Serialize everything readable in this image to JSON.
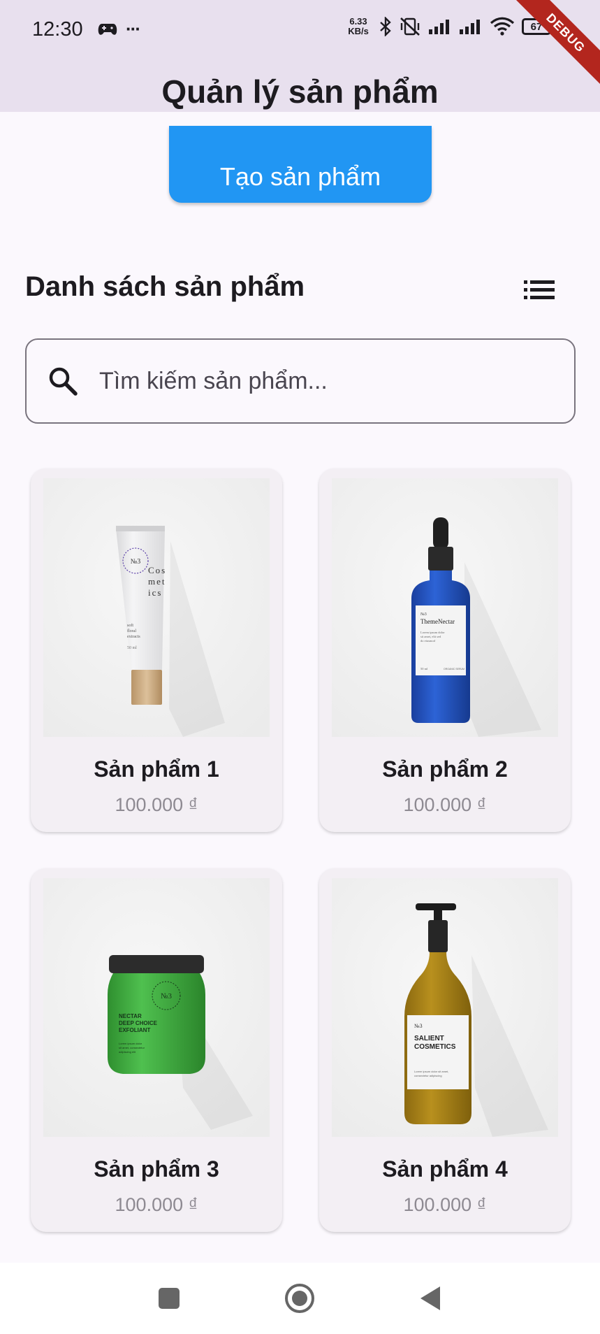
{
  "status_bar": {
    "time": "12:30",
    "more": "···",
    "net_speed_value": "6.33",
    "net_speed_unit": "KB/s",
    "battery": "67",
    "debug_banner": "DEBUG",
    "icons": [
      "game-controller-icon",
      "bluetooth-icon",
      "vibrate-off-icon",
      "signal-icon",
      "signal-icon",
      "wifi-icon",
      "battery-icon"
    ]
  },
  "app_bar": {
    "title": "Quản lý sản phẩm",
    "background": "#e8e0ee"
  },
  "actions": {
    "create_label": "Tạo sản phẩm",
    "accent": "#2196f3"
  },
  "list": {
    "title": "Danh sách sản phẩm",
    "toggle_icon": "list-icon"
  },
  "search": {
    "placeholder": "Tìm kiếm sản phẩm...",
    "icon": "search-icon"
  },
  "products": [
    {
      "name": "Sản phẩm 1",
      "price": "100.000 ₫",
      "image": "cosmetic-tube"
    },
    {
      "name": "Sản phẩm 2",
      "price": "100.000 ₫",
      "image": "dropper-bottle"
    },
    {
      "name": "Sản phẩm 3",
      "price": "100.000 ₫",
      "image": "green-jar"
    },
    {
      "name": "Sản phẩm 4",
      "price": "100.000 ₫",
      "image": "pump-bottle"
    }
  ],
  "product_labels": {
    "tube": {
      "badge": "№3",
      "brand_lines": [
        "Cos",
        "met",
        "ics"
      ],
      "ring": "COSMETICS · NATURAL ·",
      "note": [
        "soft",
        "floral",
        "extracts"
      ],
      "volume": "50 ml"
    },
    "dropper": {
      "badge": "№3",
      "brand": "ThemeNectar",
      "desc": [
        "Lorem ipsum dolor",
        "sit amet, elit sed",
        "do eiusmod"
      ],
      "volume": "50 ml",
      "footer": "ORGANIC SERUM"
    },
    "jar": {
      "badge": "№3",
      "ring": "NECTAR · SALIENT ·",
      "brand_lines": [
        "NECTAR",
        "DEEP CHOICE",
        "EXFOLIANT"
      ],
      "desc": [
        "Lorem ipsum dolor",
        "sit amet, consectetur",
        "adipiscing elit"
      ]
    },
    "pump": {
      "badge": "№3",
      "brand_lines": [
        "SALIENT",
        "COSMETICS"
      ],
      "desc": [
        "Lorem ipsum dolor sit amet,",
        "consectetur adipiscing"
      ]
    }
  },
  "navigation": {
    "buttons": [
      "recents-button",
      "home-button",
      "back-button"
    ]
  }
}
